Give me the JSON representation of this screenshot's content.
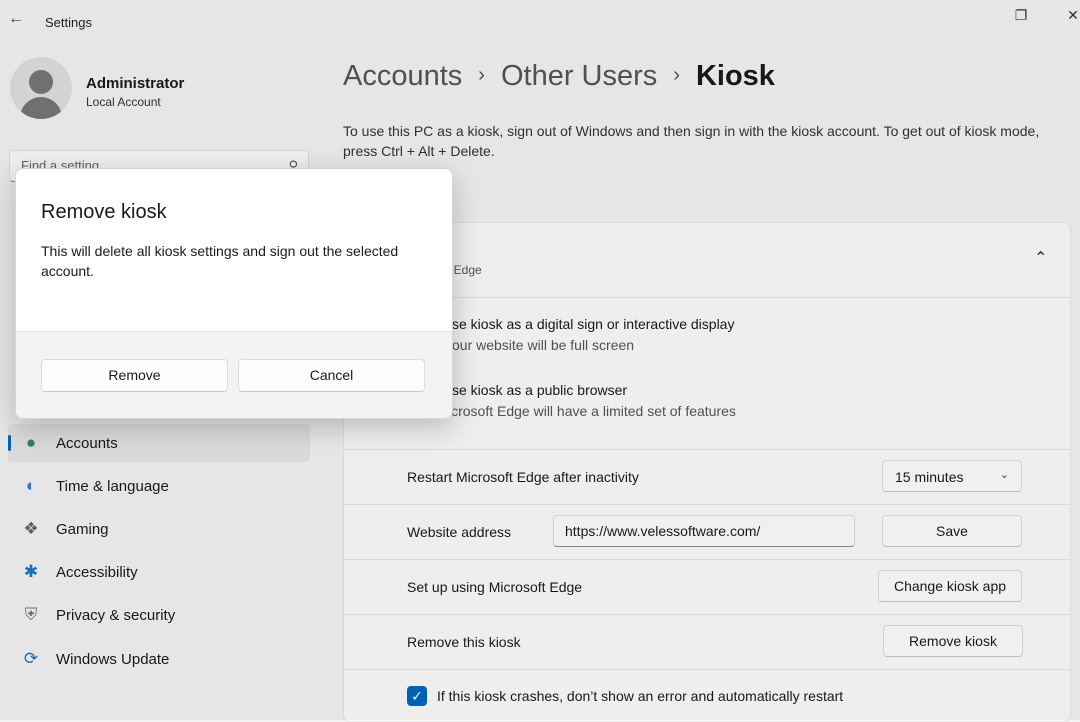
{
  "window": {
    "title": "Settings"
  },
  "user": {
    "name": "Administrator",
    "type": "Local Account"
  },
  "search": {
    "placeholder": "Find a setting"
  },
  "nav": [
    {
      "label": "Accounts",
      "icon": "accounts-icon",
      "selected": true
    },
    {
      "label": "Time & language",
      "icon": "globe-clock-icon"
    },
    {
      "label": "Gaming",
      "icon": "gamepad-icon"
    },
    {
      "label": "Accessibility",
      "icon": "accessibility-icon"
    },
    {
      "label": "Privacy & security",
      "icon": "shield-icon"
    },
    {
      "label": "Windows Update",
      "icon": "update-icon"
    }
  ],
  "breadcrumb": {
    "item1": "Accounts",
    "item2": "Other Users",
    "current": "Kiosk"
  },
  "description": "To use this PC as a kiosk, sign out of Windows and then sign in with the kiosk account. To get out of kiosk mode, press Ctrl + Alt + Delete.",
  "kiosk": {
    "subtitle_partial": "oft Edge",
    "option1_title_partial": "se kiosk as a digital sign or interactive display",
    "option1_sub_partial": "our website will be full screen",
    "option2_title_partial": "se kiosk as a public browser",
    "option2_sub_partial": "icrosoft Edge will have a limited set of features",
    "restart_label": "Restart Microsoft Edge after inactivity",
    "restart_value": "15 minutes",
    "website_label": "Website address",
    "website_value": "https://www.velessoftware.com/",
    "save_label": "Save",
    "setup_label": "Set up using Microsoft Edge",
    "change_label": "Change kiosk app",
    "remove_row_label": "Remove this kiosk",
    "remove_button_label": "Remove kiosk",
    "crash_label": "If this kiosk crashes, don’t show an error and automatically restart",
    "crash_checked": true
  },
  "dialog": {
    "title": "Remove kiosk",
    "message": "This will delete all kiosk settings and sign out the selected account.",
    "primary": "Remove",
    "secondary": "Cancel"
  },
  "colors": {
    "accent": "#0067c0",
    "background": "#f3f3f3"
  }
}
